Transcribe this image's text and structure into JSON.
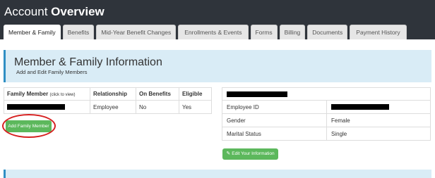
{
  "header": {
    "title_normal": "Account ",
    "title_bold": "Overview"
  },
  "tabs": [
    {
      "label": "Member & Family",
      "active": true
    },
    {
      "label": "Benefits"
    },
    {
      "label": "Mid-Year Benefit Changes"
    },
    {
      "label": "Enrollments & Events"
    },
    {
      "label": "Forms"
    },
    {
      "label": "Billing"
    },
    {
      "label": "Documents"
    },
    {
      "label": "Payment History"
    }
  ],
  "panel": {
    "title": "Member & Family Information",
    "subtitle": "Add and Edit Family Members"
  },
  "members_table": {
    "headers": {
      "family_member": "Family Member",
      "family_member_hint": "(click to view)",
      "relationship": "Relationship",
      "on_benefits": "On Benefits",
      "eligible": "Eligible"
    },
    "rows": [
      {
        "relationship": "Employee",
        "on_benefits": "No",
        "eligible": "Yes"
      }
    ]
  },
  "add_button_label": "Add Family Member",
  "info_table": {
    "rows": [
      {
        "label": "Employee ID"
      },
      {
        "label": "Gender",
        "value": "Female"
      },
      {
        "label": "Marital Status",
        "value": "Single"
      }
    ]
  },
  "edit_button_label": "Edit Your Information",
  "icons": {
    "edit": "pencil-square-icon"
  },
  "colors": {
    "header_bg": "#2f343b",
    "panel_bg": "#d9ecf6",
    "panel_accent": "#2f8fc4",
    "button_green": "#5cb85c",
    "highlight_oval": "#d62020"
  }
}
